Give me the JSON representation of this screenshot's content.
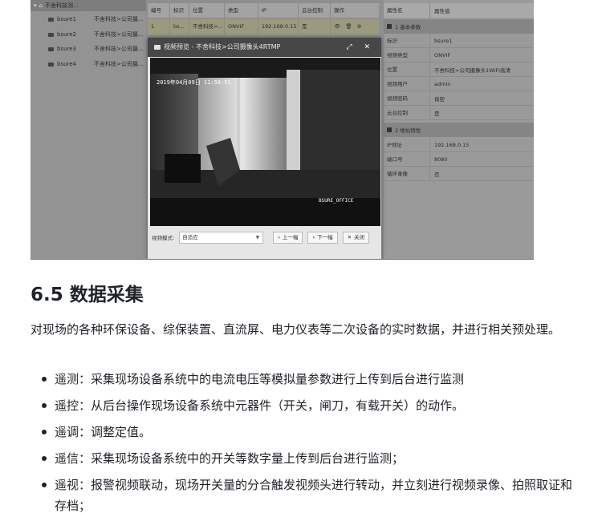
{
  "screenshot": {
    "tree": {
      "root": "不舍科技测...",
      "items": [
        {
          "name": "bsure1",
          "path": "不舍科技>公司摄..."
        },
        {
          "name": "bsure2",
          "path": "不舍科技>公司摄..."
        },
        {
          "name": "bsure3",
          "path": "不舍科技>公司摄..."
        },
        {
          "name": "bsure4",
          "path": "不舍科技>公司摄..."
        }
      ]
    },
    "grid": {
      "headers": [
        "编号",
        "标识",
        "位置",
        "类型",
        "IP",
        "云台控制",
        "操作"
      ],
      "row": [
        "1",
        "bs...",
        "不舍科技>...",
        "ONVIF",
        "192.168.0.15",
        "是",
        "👁 🗑 ⚙"
      ]
    },
    "props": {
      "headers": [
        "属性名",
        "属性值"
      ],
      "groups": [
        {
          "title": "1 基本参数",
          "rows": [
            {
              "k": "标识",
              "v": "bsure1"
            },
            {
              "k": "视频类型",
              "v": "ONVIF"
            },
            {
              "k": "位置",
              "v": "不舍科技>公司摄像头1WIFI高清"
            },
            {
              "k": "视频用户",
              "v": "admin"
            },
            {
              "k": "视频密码",
              "v": "保密"
            },
            {
              "k": "云台控制",
              "v": "是"
            }
          ]
        },
        {
          "title": "2 地址特性",
          "rows": [
            {
              "k": "IP地址",
              "v": "192.168.0.15"
            },
            {
              "k": "端口号",
              "v": "8080"
            },
            {
              "k": "循环录像",
              "v": "否"
            }
          ]
        }
      ]
    },
    "modal": {
      "title": "视频预览 - 不舍科技>公司摄像头4RTMP",
      "window_controls": "⤢ ✕",
      "overlay_time": "2019年04月09日  11:59:51",
      "overlay_name": "BSURE_OFFICE",
      "mode_label": "视频模式:",
      "mode_value": "自适应",
      "prev": "上一幅",
      "next": "下一幅",
      "close": "关闭"
    }
  },
  "article": {
    "heading": "6.5 数据采集",
    "intro": "对现场的各种环保设备、综保装置、直流屏、电力仪表等二次设备的实时数据，并进行相关预处理。",
    "items": [
      "遥测：采集现场设备系统中的电流电压等模拟量参数进行上传到后台进行监测",
      "遥控：从后台操作现场设备系统中元器件（开关，闸刀，有载开关）的动作。",
      "遥调：调整定值。",
      "遥信：采集现场设备系统中的开关等数字量上传到后台进行监测；",
      "遥视：报警视频联动，现场开关量的分合触发视频头进行转动，并立刻进行视频录像、拍照取证和存档；"
    ]
  }
}
